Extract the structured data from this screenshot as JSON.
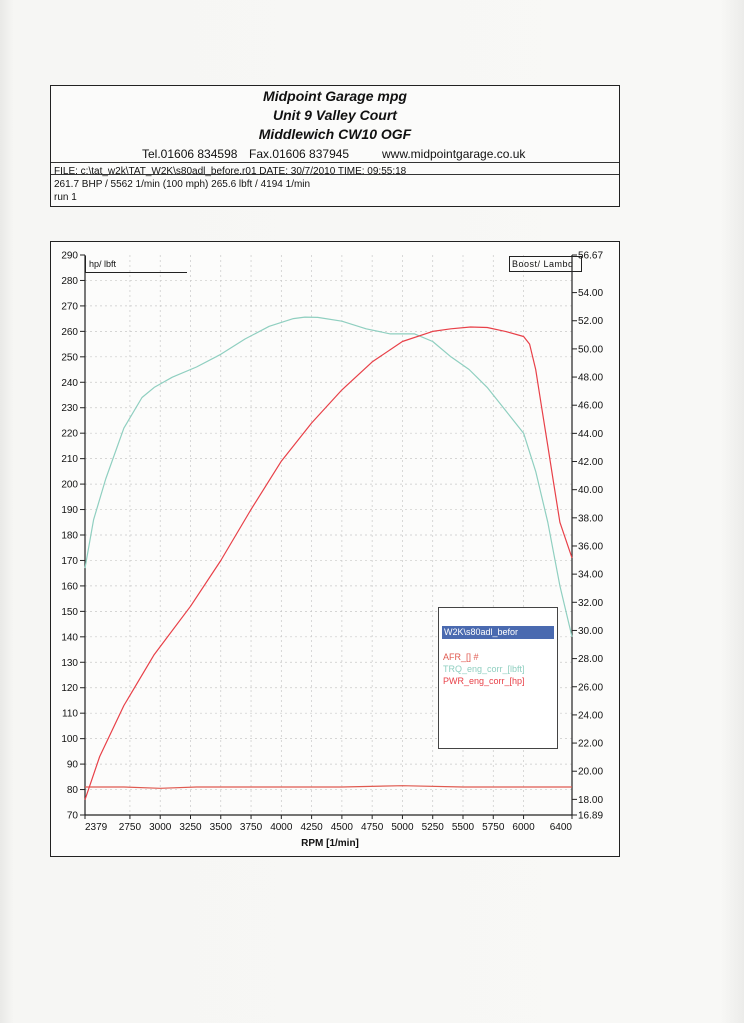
{
  "header": {
    "line1": "Midpoint Garage  mpg",
    "line2": "Unit 9 Valley Court",
    "line3": "Middlewich CW10 OGF",
    "tel": "Tel.01606 834598",
    "fax": "Fax.01606 837945",
    "web": "www.midpointgarage.co.uk",
    "file": "FILE: c:\\tat_w2k\\TAT_W2K\\s80adl_before.r01  DATE: 30/7/2010  TIME: 09:55:18",
    "result": "261.7 BHP / 5562 1/min (100 mph)    265.6 lbft / 4194 1/min",
    "run": "run  1"
  },
  "chart_data": {
    "type": "line",
    "xlabel": "RPM  [1/min]",
    "ylabel_left": "hp/ lbft",
    "ylabel_right": "Boost/ Lambd",
    "xlim": [
      2379,
      6400
    ],
    "ylim_left": [
      70,
      290
    ],
    "ylim_right": [
      16.89,
      56.67
    ],
    "x_tick_labels": [
      "2379",
      "2750",
      "3000",
      "3250",
      "3500",
      "3750",
      "4000",
      "4250",
      "4500",
      "4750",
      "5000",
      "5250",
      "5500",
      "5750",
      "6000",
      "6400"
    ],
    "x_ticks": [
      2379,
      2750,
      3000,
      3250,
      3500,
      3750,
      4000,
      4250,
      4500,
      4750,
      5000,
      5250,
      5500,
      5750,
      6000,
      6400
    ],
    "y_left_ticks": [
      70,
      80,
      90,
      100,
      110,
      120,
      130,
      140,
      150,
      160,
      170,
      180,
      190,
      200,
      210,
      220,
      230,
      240,
      250,
      260,
      270,
      280,
      290
    ],
    "y_left_tick_labels": [
      "70",
      "80",
      "90",
      "100",
      "110",
      "120",
      "130",
      "140",
      "150",
      "160",
      "170",
      "180",
      "190",
      "200",
      "210",
      "220",
      "230",
      "240",
      "250",
      "260",
      "270",
      "280",
      "290"
    ],
    "y_right_ticks": [
      16.89,
      18.0,
      20.0,
      22.0,
      24.0,
      26.0,
      28.0,
      30.0,
      32.0,
      34.0,
      36.0,
      38.0,
      40.0,
      42.0,
      44.0,
      46.0,
      48.0,
      50.0,
      52.0,
      54.0,
      56.67
    ],
    "y_right_tick_labels": [
      "16.89",
      "18.00",
      "20.00",
      "22.00",
      "24.00",
      "26.00",
      "28.00",
      "30.00",
      "32.00",
      "34.00",
      "36.00",
      "38.00",
      "40.00",
      "42.00",
      "44.00",
      "46.00",
      "48.00",
      "50.00",
      "52.00",
      "54.00",
      "56.67"
    ],
    "grid": true,
    "legend_title": "W2K\\s80adl_befor",
    "series": [
      {
        "name": "AFR_[] #",
        "color": "#e05a50",
        "axis": "left",
        "x": [
          2379,
          2700,
          3000,
          3300,
          3600,
          4000,
          4500,
          5000,
          5500,
          6000,
          6400
        ],
        "y": [
          81,
          81,
          80.5,
          81,
          81,
          81,
          81,
          81.5,
          81,
          81,
          81
        ]
      },
      {
        "name": "TRQ_eng_corr_[lbft]",
        "color": "#8fcfc0",
        "axis": "left",
        "x": [
          2379,
          2450,
          2550,
          2700,
          2850,
          2950,
          3100,
          3300,
          3500,
          3700,
          3900,
          4100,
          4194,
          4300,
          4500,
          4700,
          4900,
          5100,
          5250,
          5400,
          5550,
          5700,
          5850,
          6000,
          6100,
          6200,
          6300,
          6400
        ],
        "y": [
          167,
          186,
          202,
          222,
          234,
          238,
          242,
          246,
          251,
          257,
          262,
          265,
          265.6,
          265.5,
          264,
          261,
          259,
          259,
          256,
          250,
          245,
          238,
          229,
          220,
          205,
          185,
          160,
          140
        ]
      },
      {
        "name": "PWR_eng_corr_[hp]",
        "color": "#e84048",
        "axis": "left",
        "x": [
          2379,
          2500,
          2700,
          2950,
          3250,
          3500,
          3750,
          4000,
          4250,
          4500,
          4750,
          5000,
          5250,
          5400,
          5562,
          5700,
          5850,
          6000,
          6050,
          6100,
          6150,
          6200,
          6250,
          6300,
          6400
        ],
        "y": [
          76,
          93,
          113,
          133,
          152,
          170,
          190,
          209,
          224,
          237,
          248,
          256,
          260,
          261,
          261.7,
          261.5,
          260,
          258,
          255,
          245,
          230,
          215,
          200,
          185,
          171
        ]
      }
    ]
  }
}
